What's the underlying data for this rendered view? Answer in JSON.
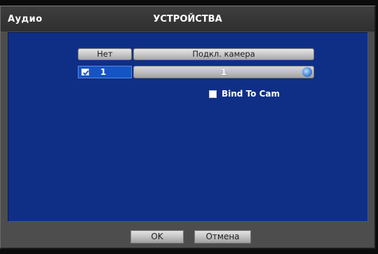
{
  "window": {
    "section_label": "Аудио",
    "title": "УСТРОЙСТВА"
  },
  "table": {
    "columns": [
      "Нет",
      "Подкл. камера"
    ],
    "rows": [
      {
        "no": "1",
        "checked": true,
        "camera": "1",
        "camera_icon": "dropdown-globe-icon"
      }
    ]
  },
  "bind_to_cam": {
    "label": "Bind To Cam",
    "checked": false
  },
  "buttons": {
    "ok": "OK",
    "cancel": "Отмена"
  },
  "colors": {
    "content_bg": "#0f2f86",
    "selected_cell": "#1554c4",
    "frame": "#4d4d4d"
  }
}
